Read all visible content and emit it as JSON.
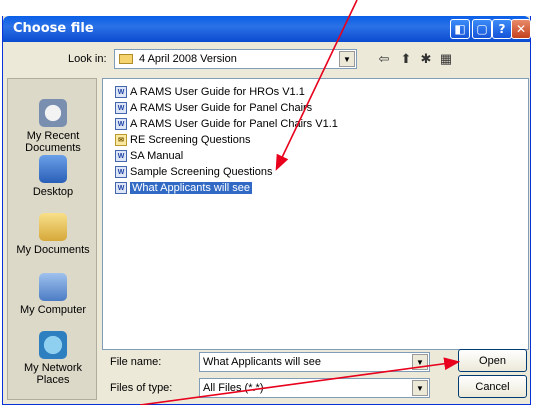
{
  "window": {
    "title": "Choose file"
  },
  "titlebar_buttons": [
    {
      "name": "help",
      "glyph": "?"
    },
    {
      "name": "close",
      "glyph": "✕"
    }
  ],
  "lookin": {
    "label": "Look in:",
    "value": "4 April 2008 Version"
  },
  "places": [
    {
      "label": "My Recent Documents",
      "icon": "recent-documents-icon"
    },
    {
      "label": "Desktop",
      "icon": "desktop-icon"
    },
    {
      "label": "My Documents",
      "icon": "my-documents-icon"
    },
    {
      "label": "My Computer",
      "icon": "my-computer-icon"
    },
    {
      "label": "My Network Places",
      "icon": "network-places-icon"
    }
  ],
  "files": [
    {
      "name": "A RAMS User Guide for HROs V1.1",
      "icon": "word-doc-icon"
    },
    {
      "name": "A RAMS User Guide for Panel Chairs",
      "icon": "word-doc-icon"
    },
    {
      "name": "A RAMS User Guide for Panel Chairs V1.1",
      "icon": "word-doc-icon"
    },
    {
      "name": "RE  Screening Questions",
      "icon": "mail-icon"
    },
    {
      "name": "SA Manual",
      "icon": "word-doc-icon"
    },
    {
      "name": "Sample Screening Questions",
      "icon": "word-doc-icon"
    },
    {
      "name": "What Applicants will see",
      "icon": "word-doc-icon",
      "selected": true
    }
  ],
  "filename": {
    "label": "File name:",
    "value": "What Applicants will see"
  },
  "filetype": {
    "label": "Files of type:",
    "value": "All Files (*.*)"
  },
  "buttons": {
    "open": "Open",
    "cancel": "Cancel"
  },
  "colors": {
    "titlebar": "#0a5fe8",
    "selection": "#316ac5",
    "annotation_arrow": "#e8001c"
  }
}
